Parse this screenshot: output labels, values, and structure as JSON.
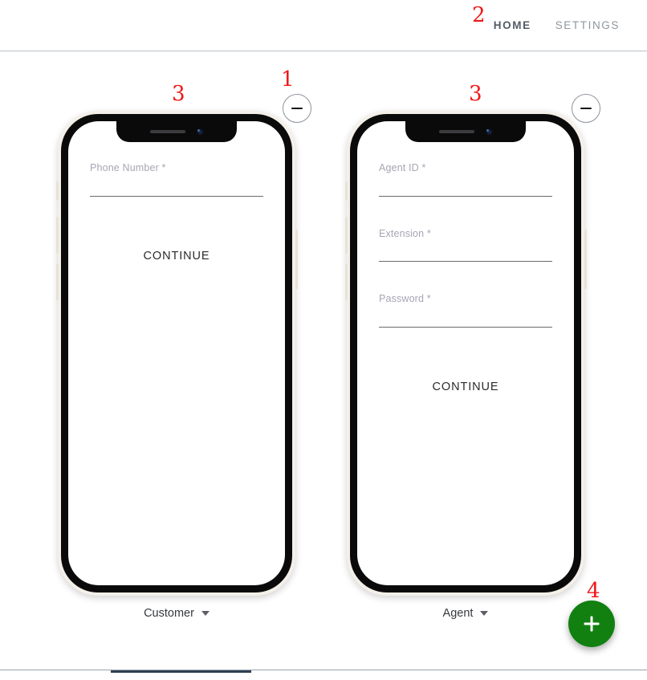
{
  "header": {
    "nav": [
      {
        "label": "HOME",
        "state": "active"
      },
      {
        "label": "SETTINGS",
        "state": "inactive"
      }
    ]
  },
  "annotations": [
    {
      "id": "1",
      "label": "1"
    },
    {
      "id": "2",
      "label": "2"
    },
    {
      "id": "3a",
      "label": "3"
    },
    {
      "id": "3b",
      "label": "3"
    },
    {
      "id": "4",
      "label": "4"
    }
  ],
  "devices": [
    {
      "role": "customer",
      "role_label": "Customer",
      "minimize_icon": "minimize-icon",
      "fields": [
        {
          "label": "Phone Number *",
          "value": "",
          "placeholder": ""
        }
      ],
      "continue_label": "CONTINUE"
    },
    {
      "role": "agent",
      "role_label": "Agent",
      "minimize_icon": "minimize-icon",
      "fields": [
        {
          "label": "Agent ID *",
          "value": "",
          "placeholder": ""
        },
        {
          "label": "Extension *",
          "value": "",
          "placeholder": ""
        },
        {
          "label": "Password *",
          "value": "",
          "placeholder": ""
        }
      ],
      "continue_label": "CONTINUE"
    }
  ],
  "fab": {
    "icon": "plus-icon",
    "label": "+",
    "color": "#118011"
  },
  "colors": {
    "accent_green": "#118011",
    "annotation_red": "#f01818",
    "nav_active": "#525c66",
    "nav_inactive": "#8e969e",
    "field_label": "#a9a4b4",
    "field_underline": "#6b6b6b",
    "phone_bezel": "#f4f0e9",
    "phone_frame": "#0a0a0a"
  }
}
